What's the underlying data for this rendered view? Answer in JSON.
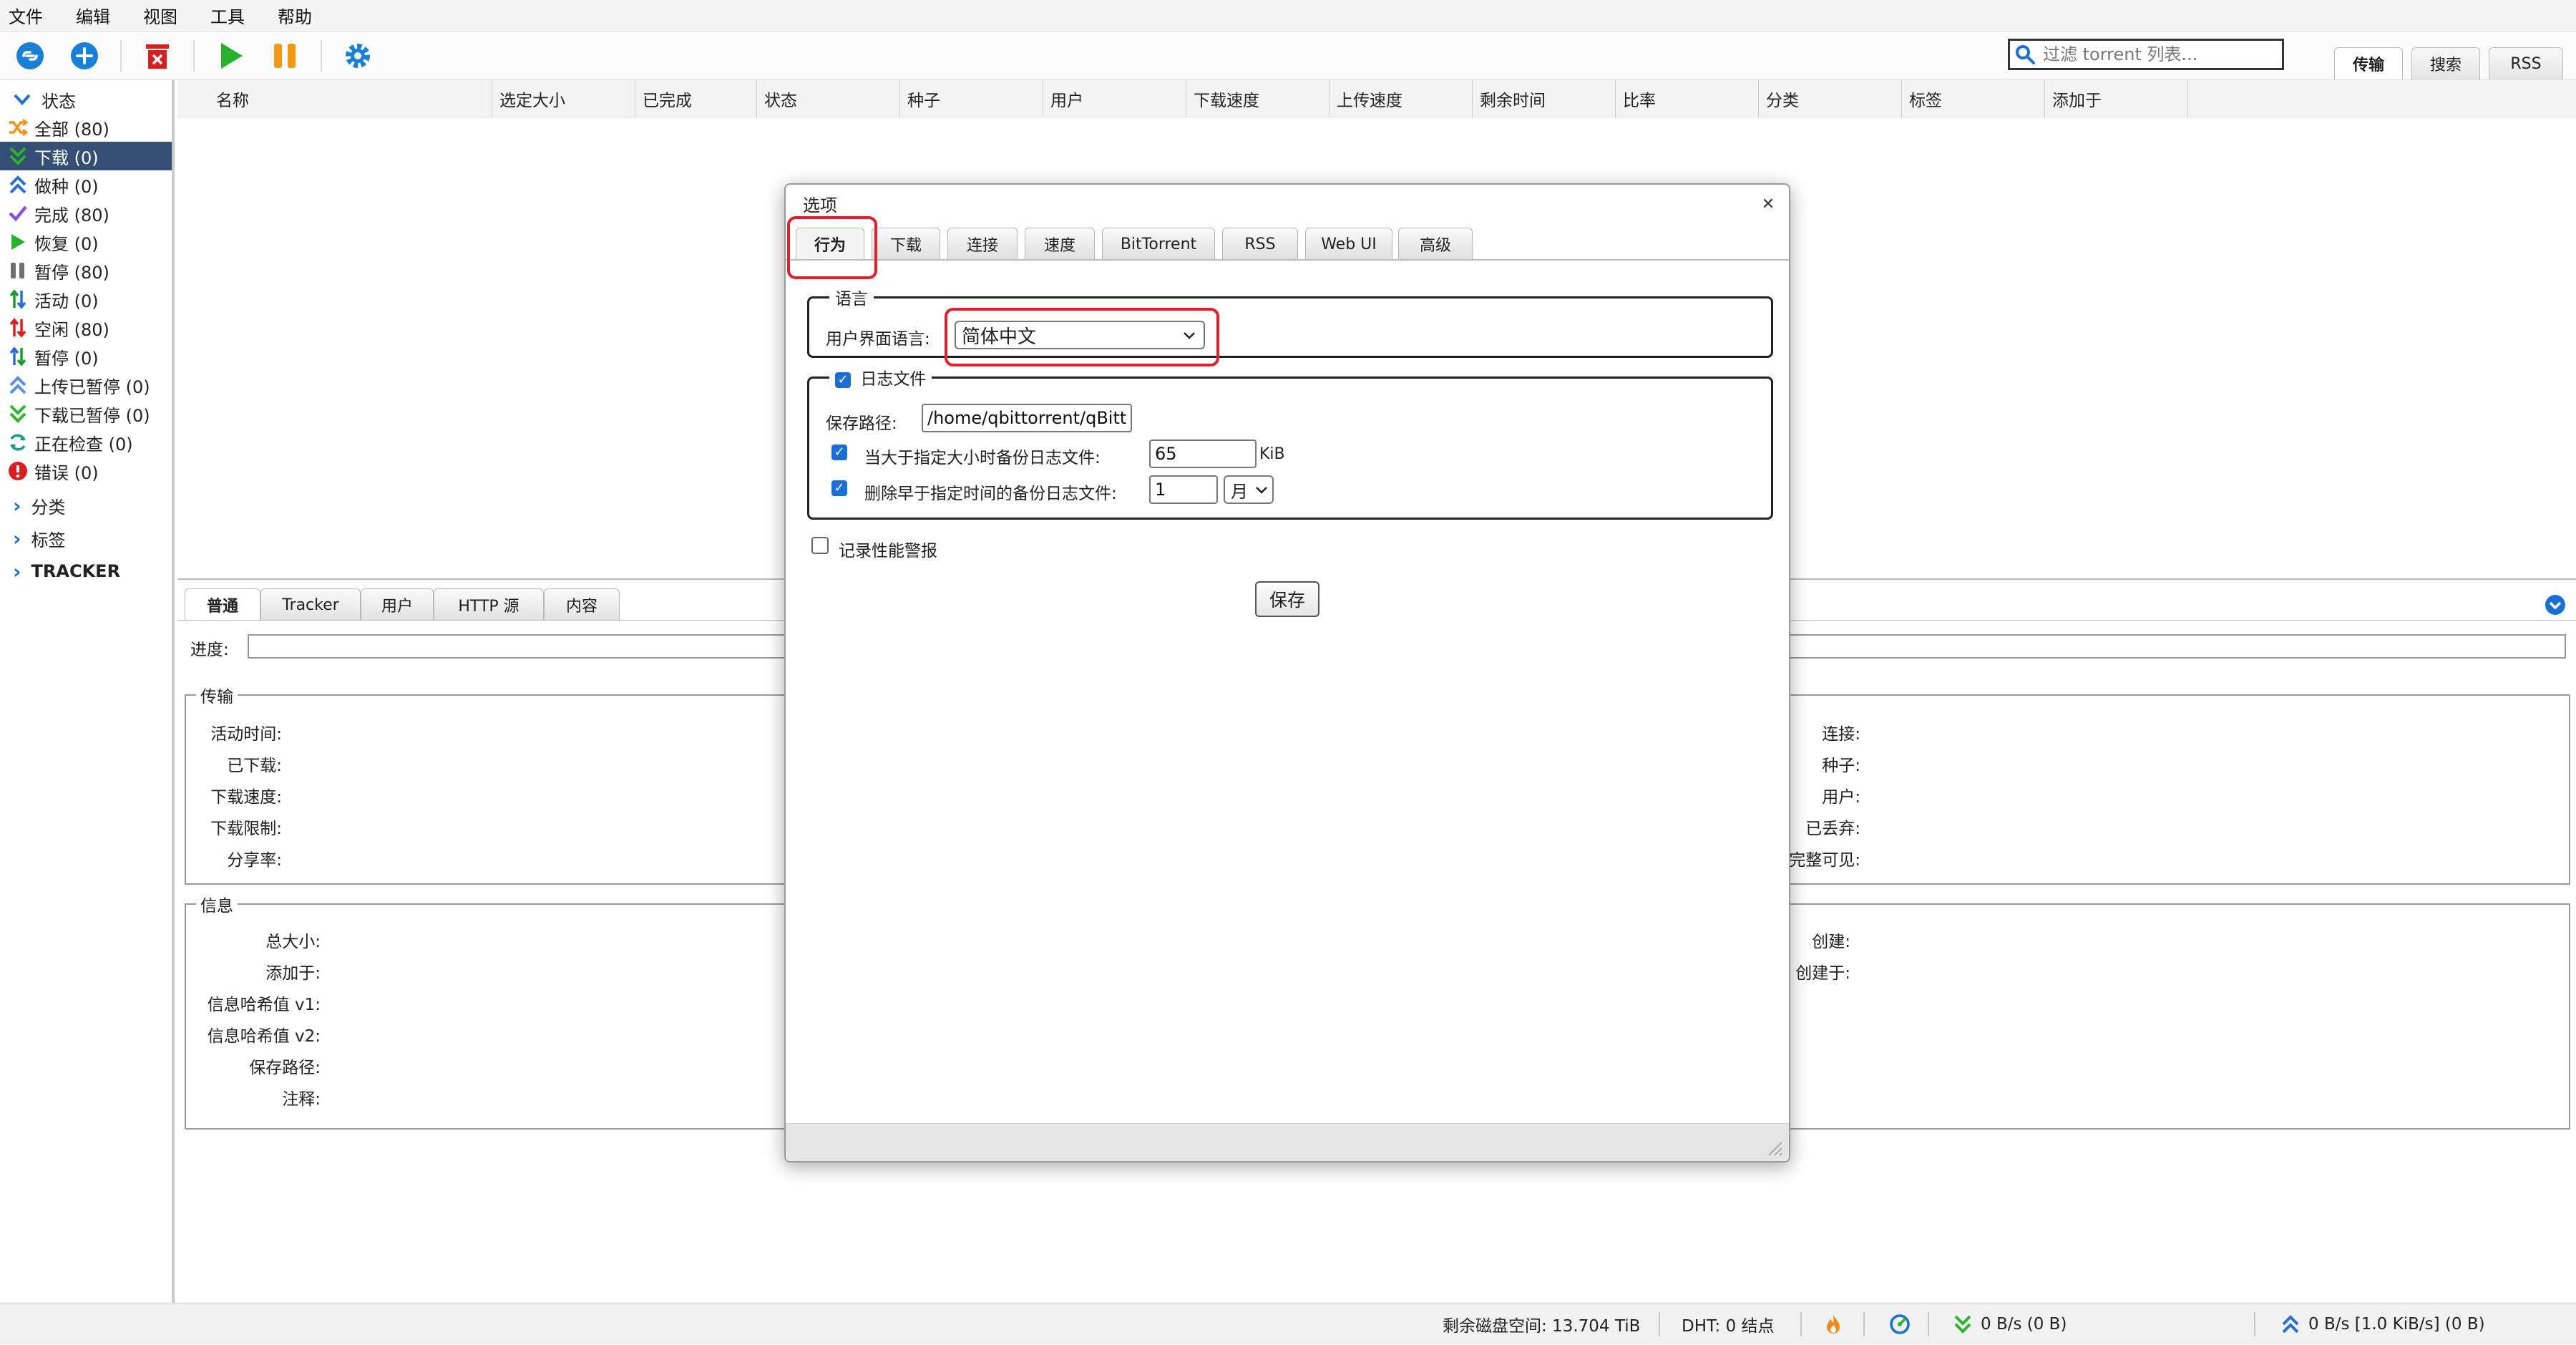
{
  "menu": [
    "文件",
    "编辑",
    "视图",
    "工具",
    "帮助"
  ],
  "filter": {
    "placeholder": "过滤 torrent 列表..."
  },
  "top_tabs": [
    "传输",
    "搜索",
    "RSS"
  ],
  "sidebar": {
    "status_header": "状态",
    "status_items": [
      {
        "label": "全部 (80)"
      },
      {
        "label": "下载 (0)"
      },
      {
        "label": "做种 (0)"
      },
      {
        "label": "完成 (80)"
      },
      {
        "label": "恢复 (0)"
      },
      {
        "label": "暂停 (80)"
      },
      {
        "label": "活动 (0)"
      },
      {
        "label": "空闲 (80)"
      },
      {
        "label": "暂停 (0)"
      },
      {
        "label": "上传已暂停 (0)"
      },
      {
        "label": "下载已暂停 (0)"
      },
      {
        "label": "正在检查 (0)"
      },
      {
        "label": "错误 (0)"
      }
    ],
    "categories": "分类",
    "tags": "标签",
    "trackers": "TRACKER"
  },
  "columns": [
    "名称",
    "选定大小",
    "已完成",
    "状态",
    "种子",
    "用户",
    "下载速度",
    "上传速度",
    "剩余时间",
    "比率",
    "分类",
    "标签",
    "添加于"
  ],
  "props": {
    "tabs": [
      "普通",
      "Tracker",
      "用户",
      "HTTP 源",
      "内容"
    ],
    "progress_label": "进度:",
    "transfer": {
      "legend": "传输",
      "left": [
        "活动时间:",
        "已下载:",
        "下载速度:",
        "下载限制:",
        "分享率:"
      ],
      "right": [
        "连接:",
        "种子:",
        "用户:",
        "已丢弃:",
        "完整可见:"
      ]
    },
    "info": {
      "legend": "信息",
      "left": [
        "总大小:",
        "添加于:",
        "信息哈希值 v1:",
        "信息哈希值 v2:",
        "保存路径:",
        "注释:"
      ],
      "right": [
        "创建:",
        "创建于:"
      ]
    }
  },
  "statusbar": {
    "disk": "剩余磁盘空间: 13.704 TiB",
    "dht": "DHT: 0 结点",
    "down": "0 B/s (0 B)",
    "up": "0 B/s [1.0 KiB/s] (0 B)"
  },
  "dialog": {
    "title": "选项",
    "tabs": [
      "行为",
      "下载",
      "连接",
      "速度",
      "BitTorrent",
      "RSS",
      "Web UI",
      "高级"
    ],
    "language": {
      "legend": "语言",
      "ui_label": "用户界面语言:",
      "selected": "简体中文"
    },
    "logfile": {
      "legend": "日志文件",
      "path_label": "保存路径:",
      "path_value": "/home/qbittorrent/qBitto",
      "backup_label": "当大于指定大小时备份日志文件:",
      "backup_value": "65",
      "backup_unit": "KiB",
      "delete_label": "删除早于指定时间的备份日志文件:",
      "delete_value": "1",
      "delete_unit": "月"
    },
    "perf_label": "记录性能警报",
    "save": "保存"
  },
  "colors": {
    "selected_row": "#354e75",
    "accent": "#1a6fd6",
    "highlight": "#e0202a"
  }
}
